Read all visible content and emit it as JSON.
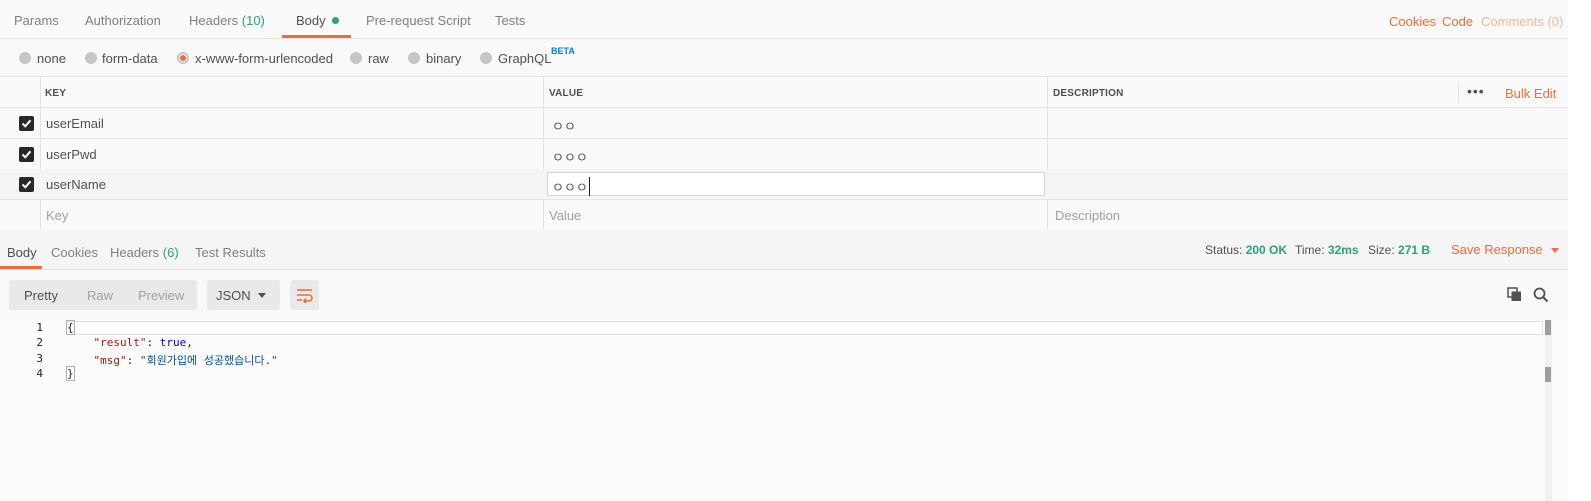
{
  "request_tabs": {
    "params": "Params",
    "authorization": "Authorization",
    "headers": "Headers",
    "headers_count": "(10)",
    "body": "Body",
    "pre_request": "Pre-request Script",
    "tests": "Tests"
  },
  "right_links": {
    "cookies": "Cookies",
    "code": "Code",
    "comments": "Comments (0)"
  },
  "body_types": {
    "none": "none",
    "form_data": "form-data",
    "urlencoded": "x-www-form-urlencoded",
    "raw": "raw",
    "binary": "binary",
    "graphql": "GraphQL",
    "beta": "BETA",
    "selected": "x-www-form-urlencoded"
  },
  "kv_table": {
    "headers": {
      "key": "KEY",
      "value": "VALUE",
      "description": "DESCRIPTION"
    },
    "bulk_edit": "Bulk Edit",
    "more": "•••",
    "rows": [
      {
        "key": "userEmail",
        "value": "ㅇㅇ",
        "checked": true
      },
      {
        "key": "userPwd",
        "value": "ㅇㅇㅇ",
        "checked": true
      },
      {
        "key": "userName",
        "value": "ㅇㅇㅇ",
        "checked": true
      }
    ],
    "placeholders": {
      "key": "Key",
      "value": "Value",
      "description": "Description"
    }
  },
  "response_tabs": {
    "body": "Body",
    "cookies": "Cookies",
    "headers": "Headers",
    "headers_count": "(6)",
    "test_results": "Test Results"
  },
  "status": {
    "status_label": "Status:",
    "status_value": "200 OK",
    "time_label": "Time:",
    "time_value": "32ms",
    "size_label": "Size:",
    "size_value": "271 B",
    "save_response": "Save Response"
  },
  "response_toolbar": {
    "pretty": "Pretty",
    "raw": "Raw",
    "preview": "Preview",
    "format": "JSON"
  },
  "code": {
    "line_numbers": [
      "1",
      "2",
      "3",
      "4"
    ],
    "open_brace": "{",
    "result_key": "\"result\"",
    "result_value": "true",
    "msg_key": "\"msg\"",
    "msg_value": "\"회원가입에 성공했습니다.\"",
    "close_brace": "}"
  },
  "colors": {
    "accent": "#f26b3a",
    "success": "#2aa37a",
    "beta": "#097bed"
  }
}
